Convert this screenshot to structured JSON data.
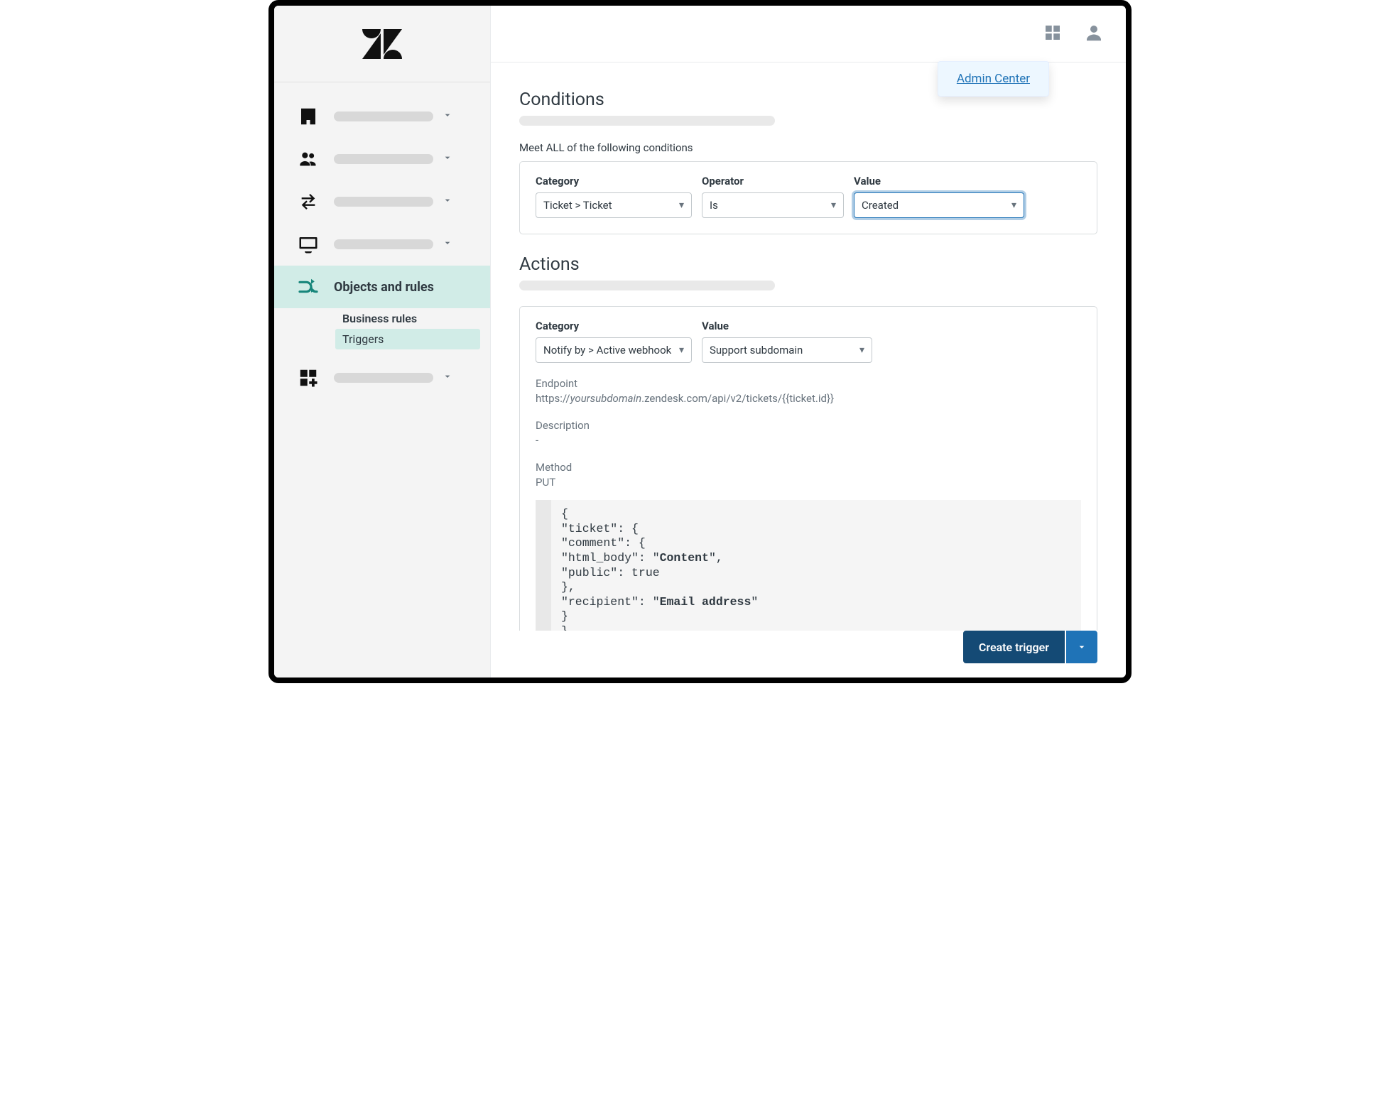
{
  "header": {
    "popover_link": "Admin Center"
  },
  "sidebar": {
    "active_label": "Objects and rules",
    "sub": {
      "business_rules": "Business rules",
      "triggers": "Triggers"
    }
  },
  "conditions": {
    "title": "Conditions",
    "meet_all_label": "Meet ALL of the following conditions",
    "labels": {
      "category": "Category",
      "operator": "Operator",
      "value": "Value"
    },
    "selects": {
      "category": "Ticket > Ticket",
      "operator": "Is",
      "value": "Created"
    }
  },
  "actions": {
    "title": "Actions",
    "labels": {
      "category": "Category",
      "value": "Value"
    },
    "selects": {
      "category": "Notify by > Active webhook",
      "value": "Support subdomain"
    },
    "endpoint_label": "Endpoint",
    "endpoint_prefix": "https://",
    "endpoint_sub": "yoursubdomain",
    "endpoint_rest": ".zendesk.com/api/v2/tickets/{{ticket.id}}",
    "description_label": "Description",
    "description_value": "-",
    "method_label": "Method",
    "method_value": "PUT",
    "code": {
      "l1": "{",
      "l2": "\"ticket\": {",
      "l3": "\"comment\": {",
      "l4a": "\"html_body\": \"",
      "l4b": "Content",
      "l4c": "\",",
      "l5": "\"public\": true",
      "l6": "},",
      "l7a": "\"recipient\": \"",
      "l7b": "Email address",
      "l7c": "\"",
      "l8": "}",
      "l9": "}"
    }
  },
  "footer": {
    "create_trigger": "Create trigger"
  }
}
